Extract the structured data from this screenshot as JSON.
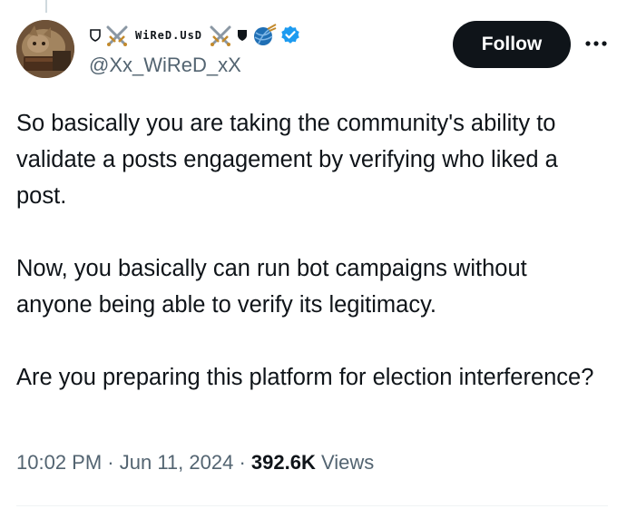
{
  "author": {
    "display_name": "WiReD.UsD",
    "handle": "@Xx_WiReD_xX",
    "verified": true,
    "name_decorations": [
      "shield-outline-icon",
      "crossed-swords-icon",
      "crossed-swords-icon",
      "shield-filled-icon",
      "yarn-ball-icon"
    ]
  },
  "actions": {
    "follow_label": "Follow",
    "more_label": "···"
  },
  "post": {
    "paragraphs": [
      "So basically you are taking the community's ability to validate a posts engagement by verifying who liked a post.",
      "Now, you basically can run bot campaigns without anyone being able to verify its legitimacy.",
      "Are you preparing this platform for election interference?"
    ],
    "time": "10:02 PM",
    "date": "Jun 11, 2024",
    "separator": "·",
    "views_count": "392.6K",
    "views_label": "Views"
  },
  "colors": {
    "text_primary": "#0f1419",
    "text_secondary": "#536471",
    "verified_blue": "#1d9bf0",
    "follow_bg": "#0f1419",
    "divider": "#eff3f4"
  }
}
